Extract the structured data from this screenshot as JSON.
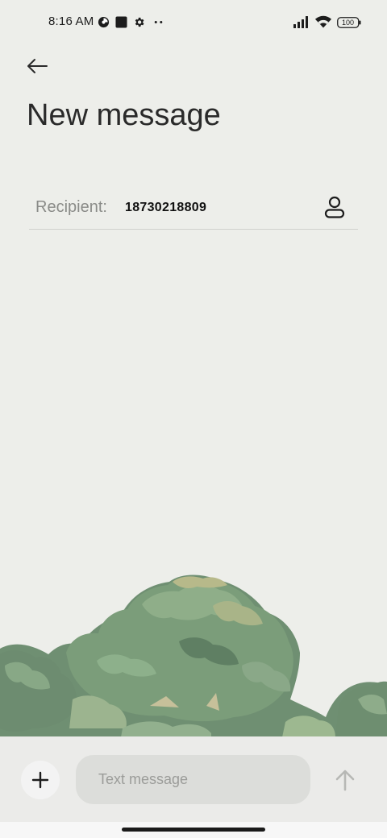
{
  "status_bar": {
    "time": "8:16 AM",
    "left_icons": [
      "data-saver-icon",
      "square-notification-icon",
      "settings-gear-icon",
      "more-notifications-icon"
    ],
    "right_icons": [
      "signal-icon",
      "wifi-icon",
      "battery-icon"
    ],
    "battery": "100"
  },
  "header": {
    "back_icon": "back-arrow-icon",
    "title": "New message"
  },
  "recipient": {
    "label": "Recipient:",
    "value": "18730218809",
    "contact_icon": "person-icon"
  },
  "composer": {
    "add_icon": "plus-icon",
    "placeholder": "Text message",
    "send_icon": "send-arrow-icon"
  }
}
